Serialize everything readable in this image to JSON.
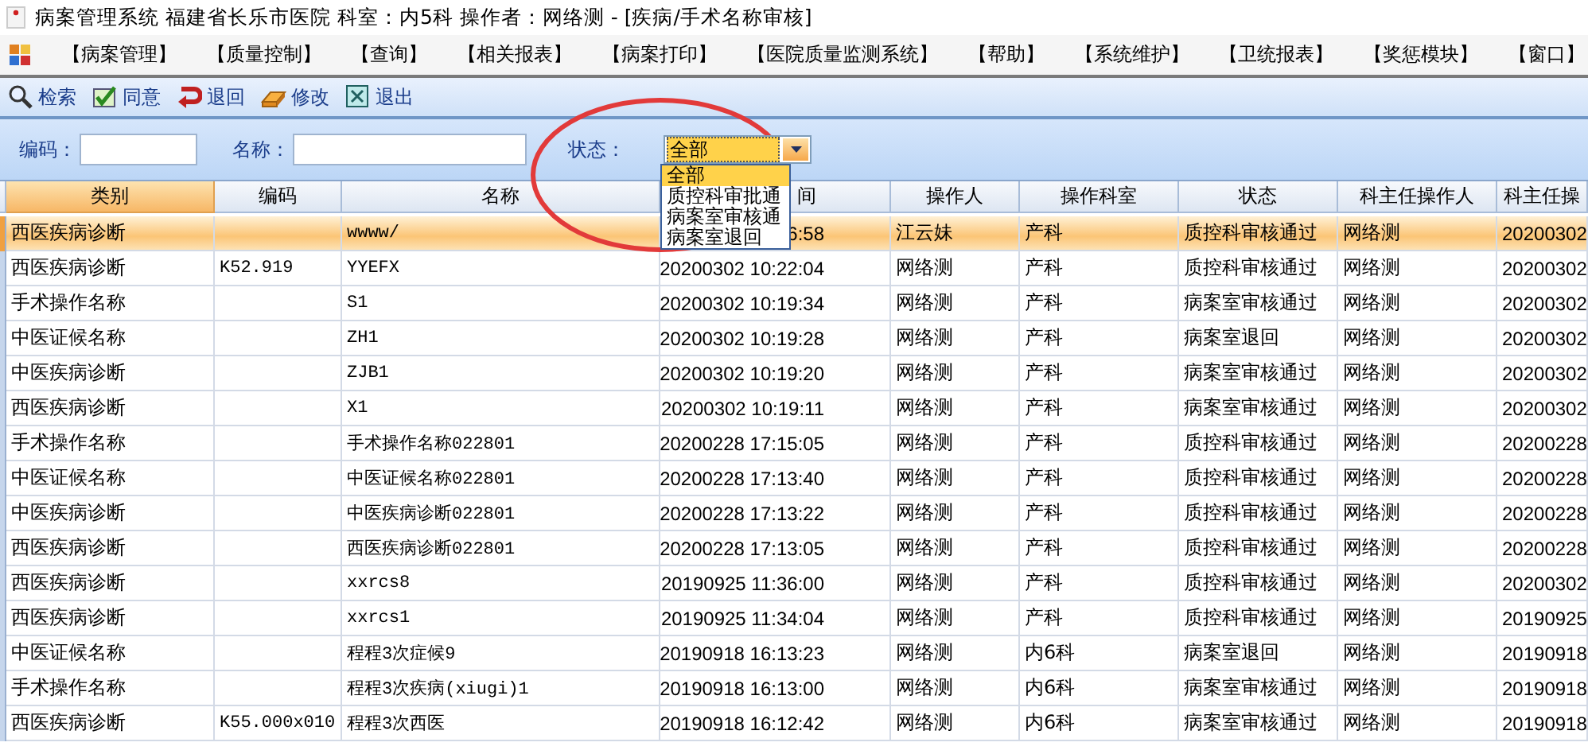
{
  "window": {
    "title": "病案管理系统  福建省长乐市医院  科室：内5科 操作者：网络测 - [疾病/手术名称审核]"
  },
  "menu": [
    "【病案管理】",
    "【质量控制】",
    "【查询】",
    "【相关报表】",
    "【病案打印】",
    "【医院质量监测系统】",
    "【帮助】",
    "【系统维护】",
    "【卫统报表】",
    "【奖惩模块】",
    "【窗口】"
  ],
  "toolbar": [
    "检索",
    "同意",
    "退回",
    "修改",
    "退出"
  ],
  "filters": [
    {
      "kind": "text",
      "label": "编码："
    },
    {
      "kind": "text",
      "label": "名称："
    },
    {
      "kind": "combo",
      "label": "状态：",
      "value": "全部",
      "expanded": true,
      "options": [
        {
          "label": "全部",
          "selected": true
        },
        {
          "label": "质控科审批通",
          "selected": false
        },
        {
          "label": "病案室审核通",
          "selected": false
        },
        {
          "label": "病案室退回",
          "selected": false
        }
      ]
    }
  ],
  "table": {
    "columns": [
      {
        "label": "类别",
        "selected": true
      },
      {
        "label": "编码",
        "selected": false
      },
      {
        "label": "名称",
        "selected": false
      },
      {
        "label": "间",
        "selected": false
      },
      {
        "label": "操作人",
        "selected": false
      },
      {
        "label": "操作科室",
        "selected": false
      },
      {
        "label": "状态",
        "selected": false
      },
      {
        "label": "科主任操作人",
        "selected": false
      },
      {
        "label": "科主任操",
        "selected": false
      }
    ],
    "rows": [
      {
        "selected": true,
        "cells": [
          "西医疾病诊断",
          "",
          "wwww/",
          "6:58",
          "江云妹",
          "产科",
          "质控科审核通过",
          "网络测",
          "20200302"
        ]
      },
      {
        "selected": false,
        "cells": [
          "西医疾病诊断",
          "K52.919",
          "YYEFX",
          "20200302 10:22:04",
          "网络测",
          "产科",
          "质控科审核通过",
          "网络测",
          "20200302"
        ]
      },
      {
        "selected": false,
        "cells": [
          "手术操作名称",
          "",
          "S1",
          "20200302 10:19:34",
          "网络测",
          "产科",
          "病案室审核通过",
          "网络测",
          "20200302"
        ]
      },
      {
        "selected": false,
        "cells": [
          "中医证候名称",
          "",
          "ZH1",
          "20200302 10:19:28",
          "网络测",
          "产科",
          "病案室退回",
          "网络测",
          "20200302"
        ]
      },
      {
        "selected": false,
        "cells": [
          "中医疾病诊断",
          "",
          "ZJB1",
          "20200302 10:19:20",
          "网络测",
          "产科",
          "病案室审核通过",
          "网络测",
          "20200302"
        ]
      },
      {
        "selected": false,
        "cells": [
          "西医疾病诊断",
          "",
          "X1",
          "20200302 10:19:11",
          "网络测",
          "产科",
          "病案室审核通过",
          "网络测",
          "20200302"
        ]
      },
      {
        "selected": false,
        "cells": [
          "手术操作名称",
          "",
          "手术操作名称022801",
          "20200228 17:15:05",
          "网络测",
          "产科",
          "质控科审核通过",
          "网络测",
          "20200228"
        ]
      },
      {
        "selected": false,
        "cells": [
          "中医证候名称",
          "",
          "中医证候名称022801",
          "20200228 17:13:40",
          "网络测",
          "产科",
          "质控科审核通过",
          "网络测",
          "20200228"
        ]
      },
      {
        "selected": false,
        "cells": [
          "中医疾病诊断",
          "",
          "中医疾病诊断022801",
          "20200228 17:13:22",
          "网络测",
          "产科",
          "质控科审核通过",
          "网络测",
          "20200228"
        ]
      },
      {
        "selected": false,
        "cells": [
          "西医疾病诊断",
          "",
          "西医疾病诊断022801",
          "20200228 17:13:05",
          "网络测",
          "产科",
          "质控科审核通过",
          "网络测",
          "20200228"
        ]
      },
      {
        "selected": false,
        "cells": [
          "西医疾病诊断",
          "",
          "xxrcs8",
          "20190925 11:36:00",
          "网络测",
          "产科",
          "质控科审核通过",
          "网络测",
          "20200302"
        ]
      },
      {
        "selected": false,
        "cells": [
          "西医疾病诊断",
          "",
          "xxrcs1",
          "20190925 11:34:04",
          "网络测",
          "产科",
          "质控科审核通过",
          "网络测",
          "20190925"
        ]
      },
      {
        "selected": false,
        "cells": [
          "中医证候名称",
          "",
          "程程3次症候9",
          "20190918 16:13:23",
          "网络测",
          "内6科",
          "病案室退回",
          "网络测",
          "20190918"
        ]
      },
      {
        "selected": false,
        "cells": [
          "手术操作名称",
          "",
          "程程3次疾病(xiugi)1",
          "20190918 16:13:00",
          "网络测",
          "内6科",
          "病案室审核通过",
          "网络测",
          "20190918"
        ]
      },
      {
        "selected": false,
        "cells": [
          "西医疾病诊断",
          "K55.000x010",
          "程程3次西医",
          "20190918 16:12:42",
          "网络测",
          "内6科",
          "病案室审核通过",
          "网络测",
          "20190918"
        ]
      }
    ]
  }
}
